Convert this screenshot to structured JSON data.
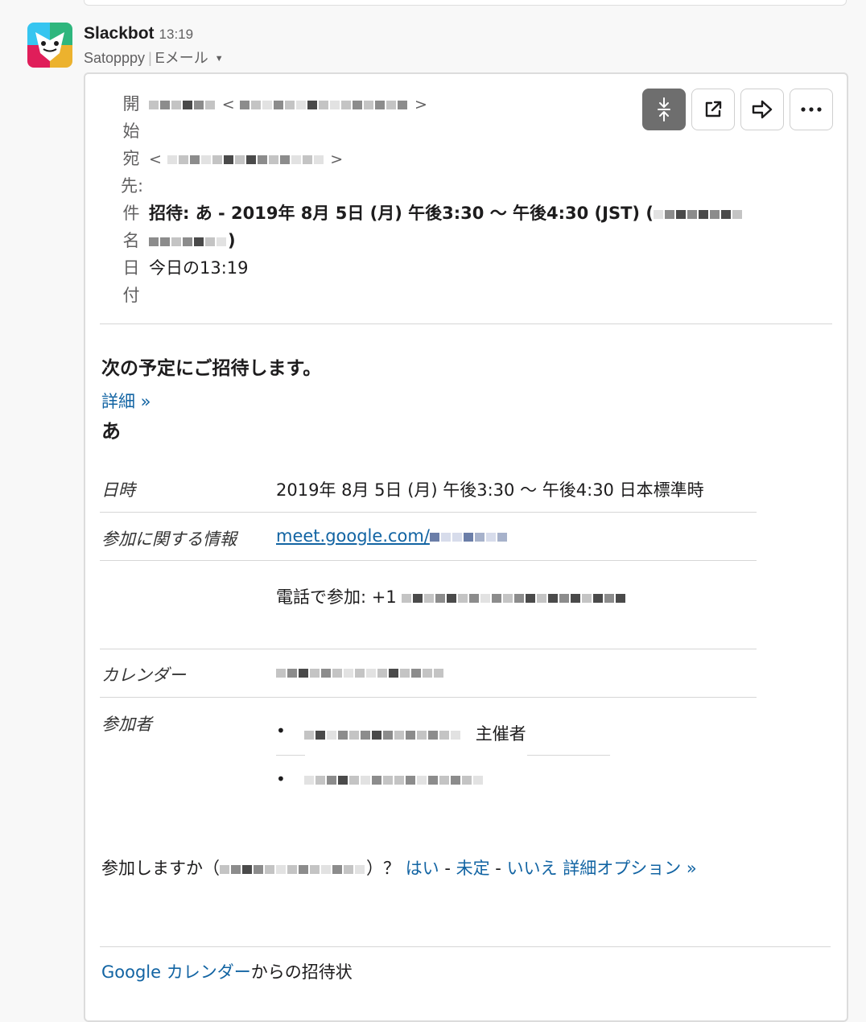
{
  "message": {
    "sender": "Slackbot",
    "time": "13:19",
    "source": "Satopppy",
    "type": "Eメール"
  },
  "email": {
    "labels": {
      "from": [
        "開",
        "始"
      ],
      "to": [
        "宛",
        "先:"
      ],
      "subject": [
        "件",
        "名"
      ],
      "date": [
        "日",
        "付"
      ]
    },
    "from_open": "<",
    "from_close": ">",
    "to_open": "<",
    "to_close": ">",
    "subject": "招待: あ - 2019年 8月 5日 (月) 午後3:30 〜 午後4:30 (JST) (",
    "subject_tail": ")",
    "date": "今日の13:19"
  },
  "toolbar": {
    "icons": [
      "collapse-icon",
      "external-link-icon",
      "forward-icon",
      "more-icon"
    ]
  },
  "body": {
    "intro": "次の予定にご招待します。",
    "details_link": "詳細 »",
    "event_title": "あ",
    "rows": {
      "datetime_label": "日時",
      "datetime_value": "2019年 8月 5日 (月) 午後3:30 〜 午後4:30 日本標準時",
      "join_label": "参加に関する情報",
      "join_link": "meet.google.com/",
      "phone_value": "電話で参加: +1",
      "calendar_label": "カレンダー",
      "attendees_label": "参加者",
      "organizer_tag": "主催者"
    },
    "rsvp": {
      "question_prefix": "参加しますか（",
      "question_suffix": "）？",
      "yes": "はい",
      "dash1": " - ",
      "maybe": "未定",
      "dash2": " - ",
      "no": "いいえ",
      "more_options": "詳細オプション »"
    },
    "footer": {
      "link": "Google カレンダー",
      "text": "からの招待状"
    }
  }
}
